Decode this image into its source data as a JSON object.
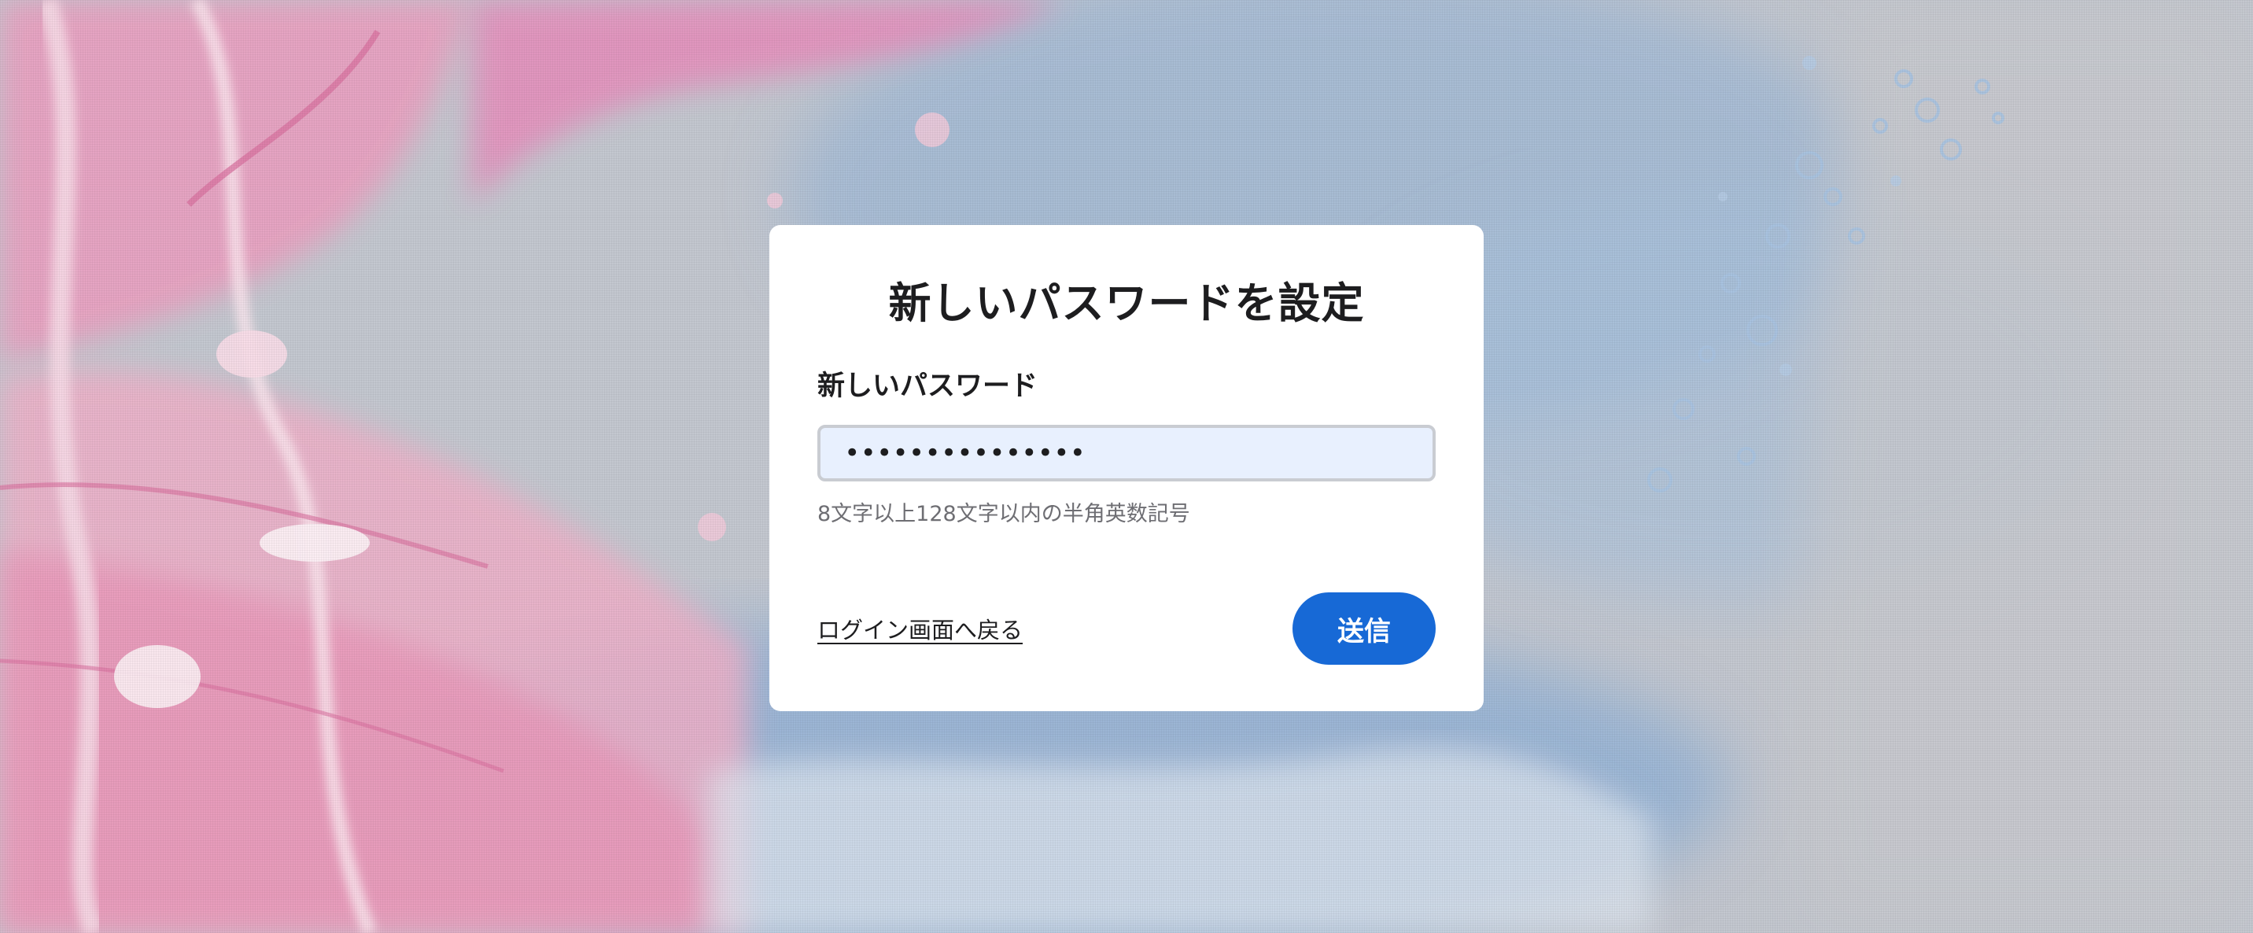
{
  "dialog": {
    "title": "新しいパスワードを設定",
    "password_label": "新しいパスワード",
    "password_value": "•••••••••••••••",
    "hint": "8文字以上128文字以内の半角英数記号",
    "back_link": "ログイン画面へ戻る",
    "submit_label": "送信"
  },
  "colors": {
    "accent": "#1769d6",
    "input_background": "#e8f0fe",
    "background_pink": "#e48fb3",
    "background_blue": "#8eb3d8"
  }
}
